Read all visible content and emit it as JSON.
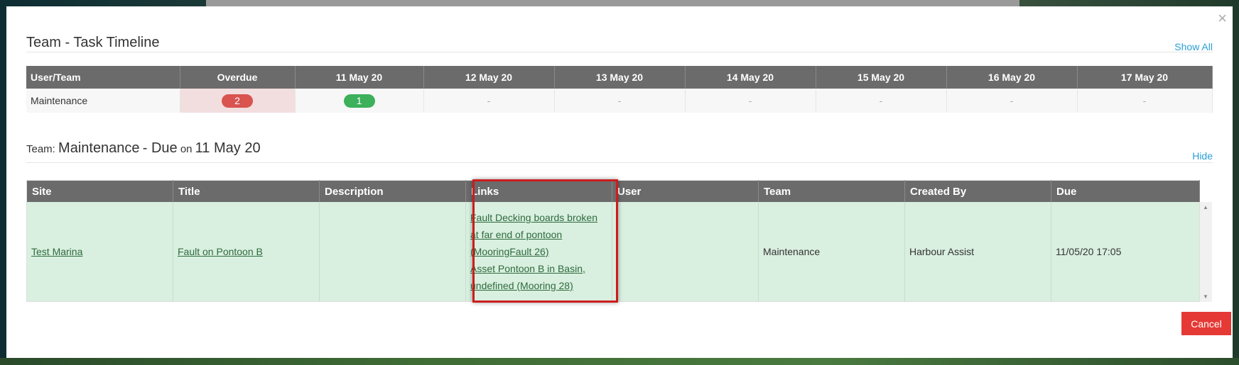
{
  "modal": {
    "close_glyph": "×"
  },
  "timeline": {
    "title": "Team - Task Timeline",
    "show_all": "Show All",
    "headers": [
      "User/Team",
      "Overdue",
      "11 May 20",
      "12 May 20",
      "13 May 20",
      "14 May 20",
      "15 May 20",
      "16 May 20",
      "17 May 20"
    ],
    "row": {
      "user": "Maintenance",
      "overdue": "2",
      "day1": "1",
      "empty": [
        "-",
        "-",
        "-",
        "-",
        "-",
        "-"
      ]
    },
    "colors": {
      "overdue_badge": "#d9534f",
      "day_badge": "#3cb05a",
      "overdue_cell": "#f2dede"
    }
  },
  "detail": {
    "title_prefix": "Team:",
    "team": "Maintenance",
    "title_mid": "- Due",
    "title_on": "on",
    "date": "11 May 20",
    "hide": "Hide",
    "headers": [
      "Site",
      "Title",
      "Description",
      "Links",
      "User",
      "Team",
      "Created By",
      "Due"
    ],
    "row": {
      "site": "Test Marina",
      "title": "Fault on Pontoon B",
      "description": "",
      "link1": "Fault Decking boards broken at far end of pontoon (MooringFault 26)",
      "link2": "Asset Pontoon B in Basin, undefined (Mooring 28)",
      "user": "",
      "team": "Maintenance",
      "created_by": "Harbour Assist",
      "due": "11/05/20 17:05"
    }
  },
  "footer": {
    "cancel": "Cancel"
  },
  "accent": {
    "cancel": "#e53935",
    "link": "#2a9fd6",
    "row_bg": "#d9efdf",
    "highlight": "#cc1d1d"
  }
}
